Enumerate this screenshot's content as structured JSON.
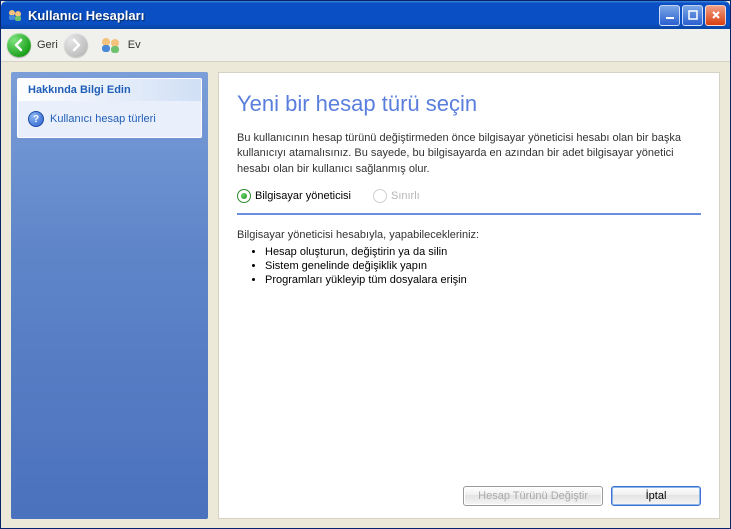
{
  "window": {
    "title": "Kullanıcı Hesapları"
  },
  "toolbar": {
    "back_label": "Geri",
    "home_label": "Ev"
  },
  "sidebar": {
    "task_header": "Hakkında Bilgi Edin",
    "links": [
      {
        "label": "Kullanıcı hesap türleri"
      }
    ]
  },
  "content": {
    "title": "Yeni bir hesap türü seçin",
    "description": "Bu kullanıcının hesap türünü değiştirmeden önce bilgisayar yöneticisi hesabı olan bir başka kullanıcıyı atamalısınız. Bu sayede, bu bilgisayarda en azından bir adet bilgisayar yönetici hesabı olan bir kullanıcı sağlanmış olur.",
    "options": {
      "admin": "Bilgisayar yöneticisi",
      "limited": "Sınırlı",
      "selected": "admin",
      "limited_enabled": false
    },
    "capabilities_title": "Bilgisayar yöneticisi hesabıyla, yapabilecekleriniz:",
    "capabilities": [
      "Hesap oluşturun, değiştirin ya da silin",
      "Sistem genelinde değişiklik yapın",
      "Programları yükleyip tüm dosyalara erişin"
    ],
    "buttons": {
      "change": "Hesap Türünü Değiştir",
      "cancel": "İptal",
      "change_enabled": false
    }
  }
}
